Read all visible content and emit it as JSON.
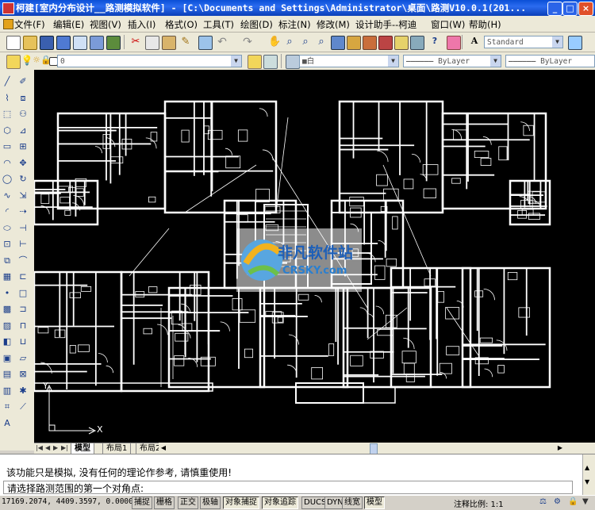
{
  "window": {
    "title": "柯建[室内分布设计__路测模拟软件] - [C:\\Documents and Settings\\Administrator\\桌面\\路测V10.0.1(201...",
    "minimize": "_",
    "maximize": "□",
    "close": "×"
  },
  "menu": {
    "items": [
      {
        "label": "文件(F)"
      },
      {
        "label": "编辑(E)"
      },
      {
        "label": "视图(V)"
      },
      {
        "label": "插入(I)"
      },
      {
        "label": "格式(O)"
      },
      {
        "label": "工具(T)"
      },
      {
        "label": "绘图(D)"
      },
      {
        "label": "标注(N)"
      },
      {
        "label": "修改(M)"
      },
      {
        "label": "设计助手--柯迪"
      },
      {
        "label": "窗口(W)"
      },
      {
        "label": "帮助(H)"
      }
    ]
  },
  "toolbar": {
    "text_style": "Standard",
    "layer_value": "0",
    "color_value": "■白",
    "linetype_value": "ByLayer",
    "lineweight_value": "ByLayer"
  },
  "layout_tabs": [
    {
      "label": "模型",
      "active": true
    },
    {
      "label": "布局1",
      "active": false
    },
    {
      "label": "布局2",
      "active": false
    }
  ],
  "command": {
    "line1": "该功能只是模拟, 没有任何的理论作参考, 请慎重使用!",
    "line2": "请选择路测范围的第一个对角点:"
  },
  "status": {
    "coordinates": "17169.2074, 4409.3597, 0.0000",
    "toggles": [
      {
        "label": "捕捉",
        "on": false
      },
      {
        "label": "栅格",
        "on": false
      },
      {
        "label": "正交",
        "on": false
      },
      {
        "label": "极轴",
        "on": false
      },
      {
        "label": "对象捕捉",
        "on": true
      },
      {
        "label": "对象追踪",
        "on": true
      },
      {
        "label": "DUCS",
        "on": false
      },
      {
        "label": "DYN",
        "on": false
      },
      {
        "label": "线宽",
        "on": false
      },
      {
        "label": "模型",
        "on": true
      }
    ],
    "annotation_scale": "注释比例: 1:1"
  },
  "ucs": {
    "x_label": "X",
    "y_label": "Y"
  },
  "watermark": {
    "line1": "非凡软件站",
    "line2": "CRSKY.com"
  },
  "colors": {
    "titlebar": "#0a4fd6",
    "canvas": "#000000",
    "drawing": "#ffffff"
  }
}
